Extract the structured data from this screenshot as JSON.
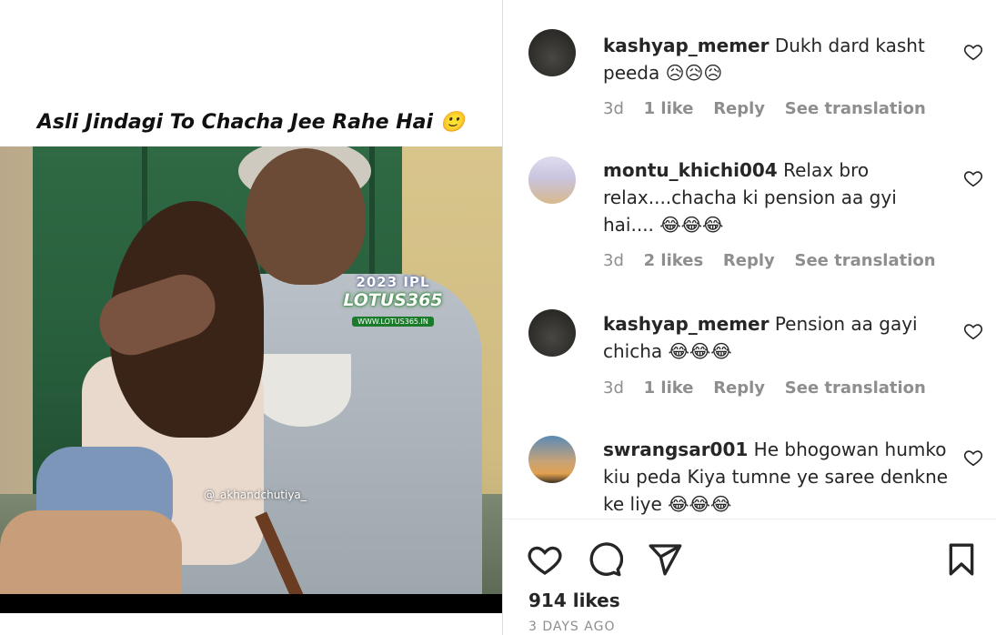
{
  "post": {
    "caption_overlay": "Asli Jindagi To Chacha Jee Rahe Hai 🙂",
    "watermark": {
      "ipl": "2023 IPL",
      "brand": "LOTUS365",
      "url": "WWW.LOTUS365.IN",
      "handle": "@_akhandchutiya_"
    }
  },
  "comments": [
    {
      "username": "kashyap_memer",
      "text": "Dukh dard kasht peeda 😥😥😥",
      "age": "3d",
      "likes": "1 like",
      "reply_label": "Reply",
      "translate_label": "See translation",
      "avatar": "avatar-dark"
    },
    {
      "username": "montu_khichi004",
      "text": "Relax bro relax....chacha ki pension aa gyi hai.... 😂😂😂",
      "age": "3d",
      "likes": "2 likes",
      "reply_label": "Reply",
      "translate_label": "See translation",
      "avatar": "avatar-room"
    },
    {
      "username": "kashyap_memer",
      "text": "Pension aa gayi chicha 😂😂😂",
      "age": "3d",
      "likes": "1 like",
      "reply_label": "Reply",
      "translate_label": "See translation",
      "avatar": "avatar-dark"
    },
    {
      "username": "swrangsar001",
      "text": "He bhogowan humko kiu peda Kiya tumne ye saree denkne ke liye 😂😂😂",
      "age": "",
      "likes": "",
      "reply_label": "",
      "translate_label": "",
      "avatar": "avatar-sunset"
    }
  ],
  "actions": {
    "icons": [
      "heart-icon",
      "comment-icon",
      "share-icon",
      "bookmark-icon"
    ]
  },
  "footer": {
    "likes": "914 likes",
    "date": "3 DAYS AGO"
  }
}
